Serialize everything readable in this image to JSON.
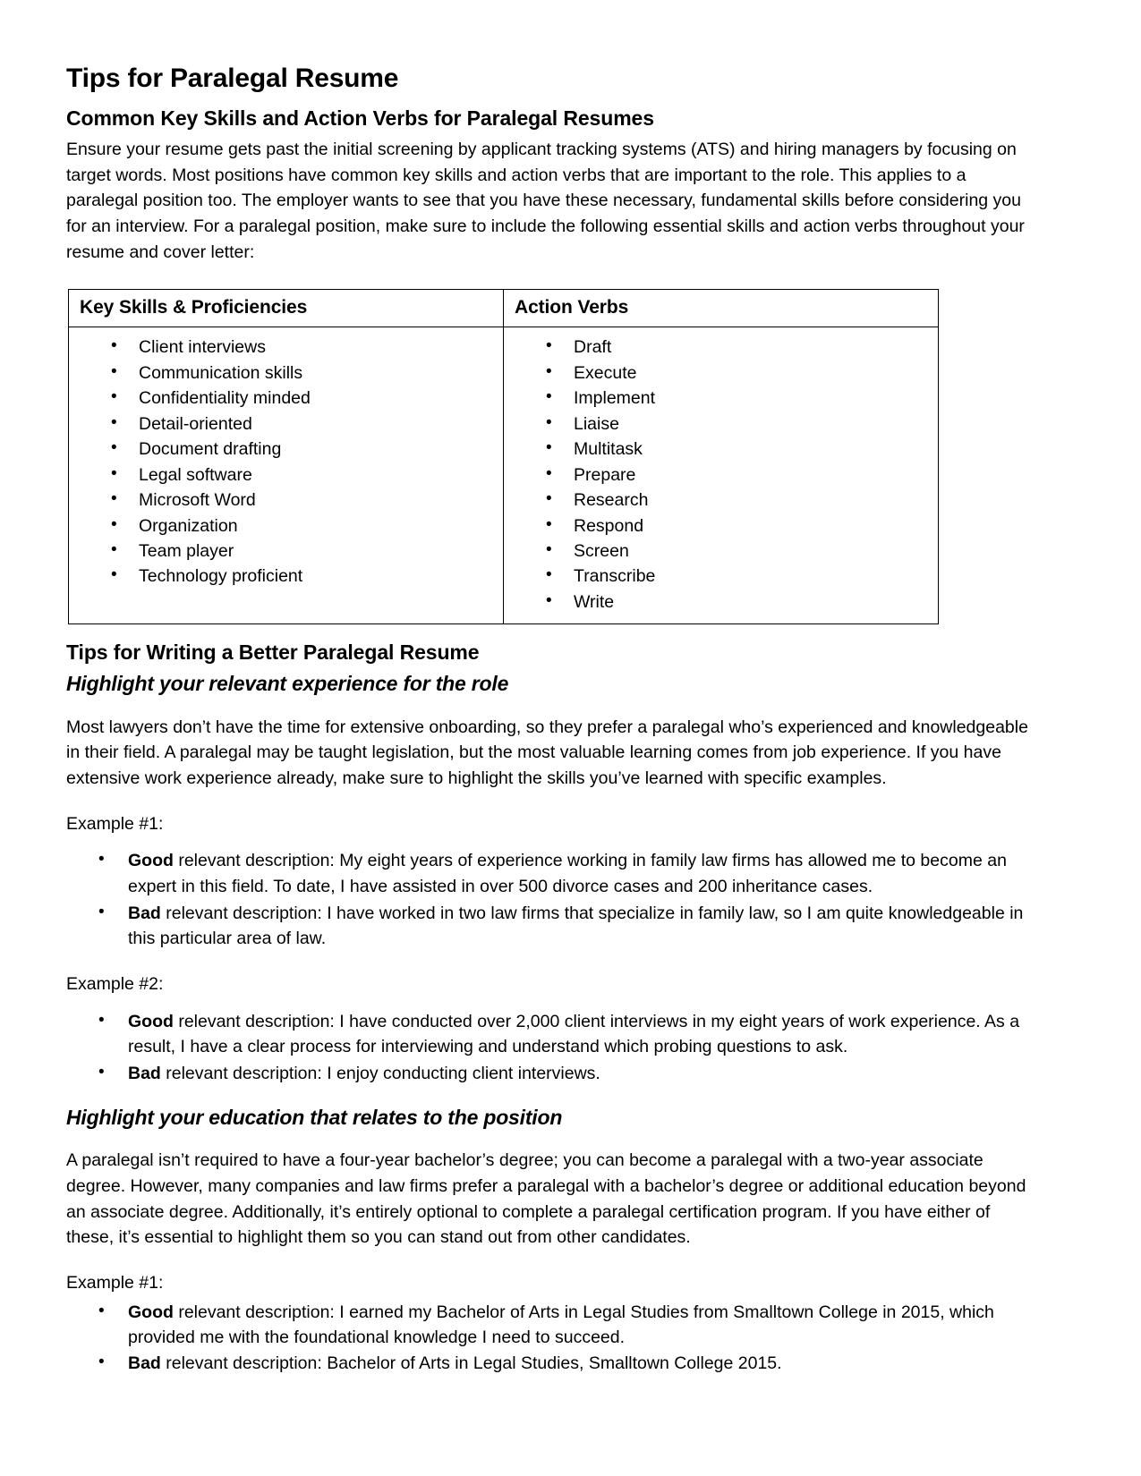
{
  "document": {
    "title": "Tips for Paralegal Resume"
  },
  "section_skills": {
    "heading": "Common Key Skills and Action Verbs for Paralegal Resumes",
    "intro": "Ensure your resume gets past the initial screening by applicant tracking systems (ATS) and hiring managers by focusing on target words. Most positions have common key skills and action verbs that are important to the role. This applies to a paralegal position too. The employer wants to see that you have these necessary, fundamental skills before considering you for an interview. For a paralegal position, make sure to include the following essential skills and action verbs throughout your resume and cover letter:",
    "table": {
      "headers": [
        "Key Skills & Proficiencies",
        "Action Verbs"
      ],
      "key_skills": [
        "Client interviews",
        "Communication skills",
        "Confidentiality minded",
        "Detail-oriented",
        "Document drafting",
        "Legal software",
        "Microsoft Word",
        "Organization",
        "Team player",
        "Technology proficient"
      ],
      "action_verbs": [
        "Draft",
        "Execute",
        "Implement",
        "Liaise",
        "Multitask",
        "Prepare",
        "Research",
        "Respond",
        "Screen",
        "Transcribe",
        "Write"
      ]
    }
  },
  "section_tips": {
    "heading": "Tips for Writing a Better Paralegal Resume",
    "subheading_experience": "Highlight your relevant experience for the role",
    "experience_paragraph": "Most lawyers don’t have the time for extensive onboarding, so they prefer a paralegal who’s experienced and knowledgeable in their field. A paralegal may be taught legislation, but the most valuable learning comes from job experience. If you have extensive work experience already, make sure to highlight the skills you’ve learned with specific examples.",
    "example1_label": "Example #1:",
    "example1": {
      "good_label": "Good",
      "good_text": " relevant description: My eight years of experience working in family law firms has allowed me to become an expert in this field. To date, I have assisted in over 500 divorce cases and 200 inheritance cases.",
      "bad_label": "Bad",
      "bad_text": " relevant description: I have worked in two law firms that specialize in family law, so I am quite knowledgeable in this particular area of law."
    },
    "example2_label": "Example #2:",
    "example2": {
      "good_label": "Good",
      "good_text": " relevant description: I have conducted over 2,000 client interviews in my eight years of work experience. As a result, I have a clear process for interviewing and understand which probing questions to ask.",
      "bad_label": "Bad",
      "bad_text": " relevant description: I enjoy conducting client interviews."
    }
  },
  "section_education": {
    "subheading": "Highlight your education that relates to the position",
    "paragraph": "A paralegal isn’t required to have a four-year bachelor’s degree; you can become a paralegal with a two-year associate degree. However, many companies and law firms prefer a paralegal with a bachelor’s degree or additional education beyond an associate degree. Additionally, it’s entirely optional to complete a paralegal certification program. If you have either of these, it’s essential to highlight them so you can stand out from other candidates.",
    "example1_label": "Example #1:",
    "example1": {
      "good_label": "Good",
      "good_text": " relevant description: I earned my Bachelor of Arts in Legal Studies from Smalltown College in 2015, which provided me with the foundational knowledge I need to succeed.",
      "bad_label": "Bad",
      "bad_text": " relevant description: Bachelor of Arts in Legal Studies, Smalltown College 2015."
    }
  }
}
